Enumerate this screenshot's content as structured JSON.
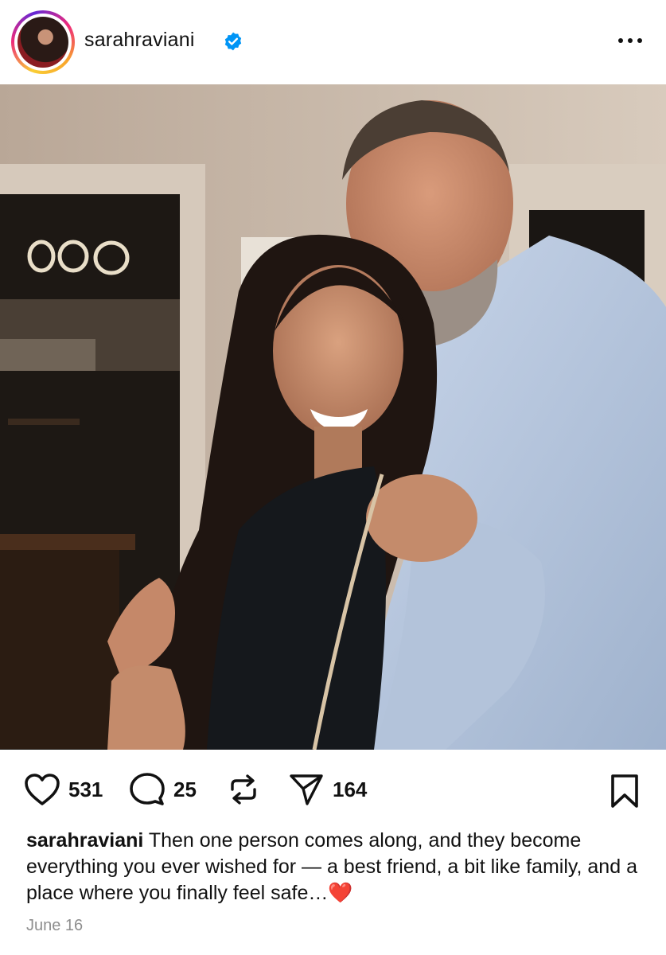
{
  "post": {
    "username": "sarahraviani",
    "verified": true,
    "photo_alt": "sarahraviani post photo",
    "likes": "531",
    "comments": "25",
    "shares": "164",
    "caption_text": "Then one person comes along, and they become everything you ever wished for — a best friend, a bit like family, and a place where you finally feel safe…",
    "caption_emoji": "❤️",
    "date": "June 16"
  },
  "icons": {
    "like": "heart-icon",
    "comment": "comment-bubble-icon",
    "repost": "repost-icon",
    "share": "send-icon",
    "save": "bookmark-icon",
    "more": "more-horizontal-icon",
    "verified": "verified-badge-icon"
  },
  "colors": {
    "verified_blue": "#0095f6",
    "text": "#111111",
    "muted": "#8e8e8e",
    "heart_emoji": "#e0245e"
  }
}
